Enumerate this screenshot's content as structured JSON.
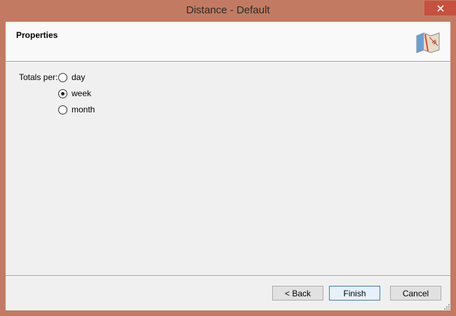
{
  "window": {
    "title": "Distance - Default",
    "close_icon": "close-icon"
  },
  "header": {
    "title": "Properties",
    "icon": "map-icon"
  },
  "form": {
    "label": "Totals per:",
    "options": [
      {
        "label": "day",
        "checked": false
      },
      {
        "label": "week",
        "checked": true
      },
      {
        "label": "month",
        "checked": false
      }
    ]
  },
  "buttons": {
    "back": "< Back",
    "finish": "Finish",
    "cancel": "Cancel"
  },
  "colors": {
    "frame": "#c27b62",
    "close": "#c7503f",
    "client": "#f0f0f0",
    "default_button_border": "#3c7fb1"
  }
}
